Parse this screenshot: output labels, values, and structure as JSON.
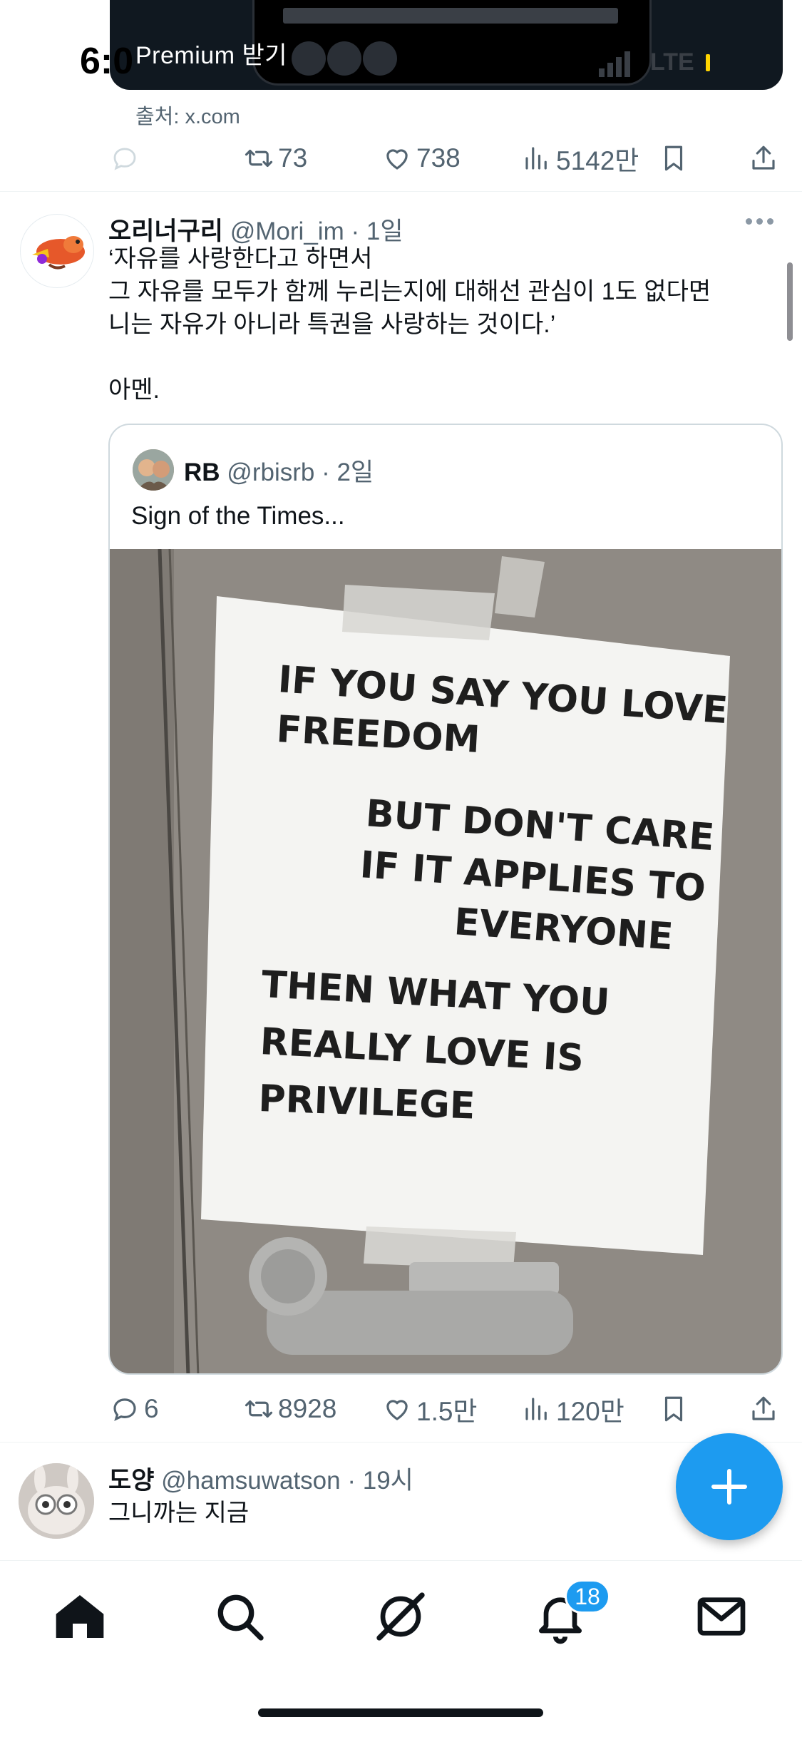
{
  "status_bar": {
    "time": "6:0",
    "network": "LTE"
  },
  "previous_tweet": {
    "media_label": "Premium 받기",
    "source": "출처: x.com",
    "actions": {
      "replies": "",
      "retweets": "73",
      "likes": "738",
      "views": "5142만"
    }
  },
  "main_tweet": {
    "name": "오리너구리",
    "handle": "@Mori_im",
    "time": "· 1일",
    "text": "‘자유를 사랑한다고 하면서\n그 자유를 모두가 함께 누리는지에 대해선 관심이 1도 없다면\n니는 자유가 아니라 특권을 사랑하는 것이다.’\n\n아멘.",
    "quote": {
      "name": "RB",
      "handle": "@rbisrb",
      "time": "· 2일",
      "text": "Sign of the Times...",
      "sign_lines": [
        "IF YOU SAY YOU LOVE",
        "FREEDOM",
        "BUT DON'T CARE",
        "IF IT APPLIES TO",
        "EVERYONE",
        "THEN WHAT YOU",
        "REALLY LOVE IS",
        "PRIVILEGE"
      ]
    },
    "actions": {
      "replies": "6",
      "retweets": "8928",
      "likes": "1.5만",
      "views": "120만"
    }
  },
  "reply_tweet": {
    "name": "도양",
    "handle": "@hamsuwatson",
    "time": "· 19시",
    "text": "그니까는 지금"
  },
  "nav": {
    "items": [
      "home-icon",
      "search-icon",
      "grok-icon",
      "notifications-icon",
      "messages-icon"
    ],
    "notification_count": "18"
  },
  "colors": {
    "accent": "#1d9bf0",
    "text": "#0f1419",
    "muted": "#536471"
  }
}
